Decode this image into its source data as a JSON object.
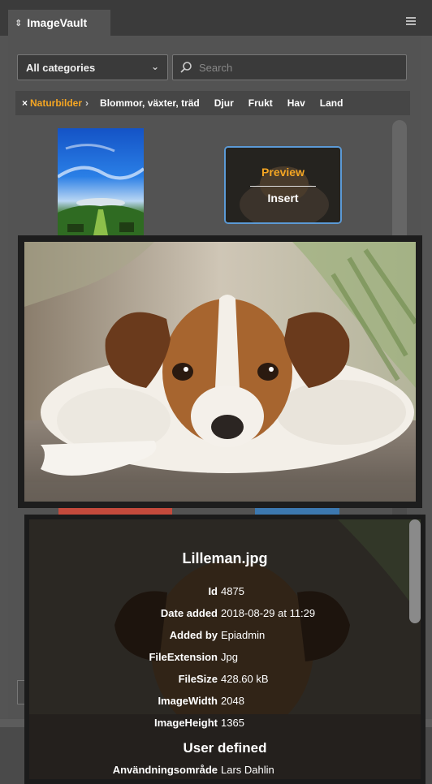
{
  "panel": {
    "tab_title": "ImageVault",
    "tab_icon": "updown-arrows-icon",
    "menu_icon": "hamburger-menu-icon"
  },
  "filter": {
    "category_select": "All categories",
    "search_placeholder": "Search"
  },
  "categories": {
    "active": "Naturbilder",
    "items": [
      "Blommor, växter, träd",
      "Djur",
      "Frukt",
      "Hav",
      "Land"
    ]
  },
  "thumbnail_actions": {
    "preview": "Preview",
    "insert": "Insert"
  },
  "details": {
    "filename": "Lilleman.jpg",
    "fields": [
      {
        "label": "Id",
        "value": "4875"
      },
      {
        "label": "Date added",
        "value": "2018-08-29 at 11:29"
      },
      {
        "label": "Added by",
        "value": "Epiadmin"
      },
      {
        "label": "FileExtension",
        "value": "Jpg"
      },
      {
        "label": "FileSize",
        "value": "428.60 kB"
      },
      {
        "label": "ImageWidth",
        "value": "2048"
      },
      {
        "label": "ImageHeight",
        "value": "1365"
      }
    ],
    "section_title": "User defined",
    "user_fields": [
      {
        "label": "Användningsområde",
        "value": "Lars Dahlin"
      }
    ]
  },
  "colors": {
    "accent_orange": "#f5a623",
    "selection_blue": "#5b9ad6",
    "panel_bg": "#535353"
  }
}
